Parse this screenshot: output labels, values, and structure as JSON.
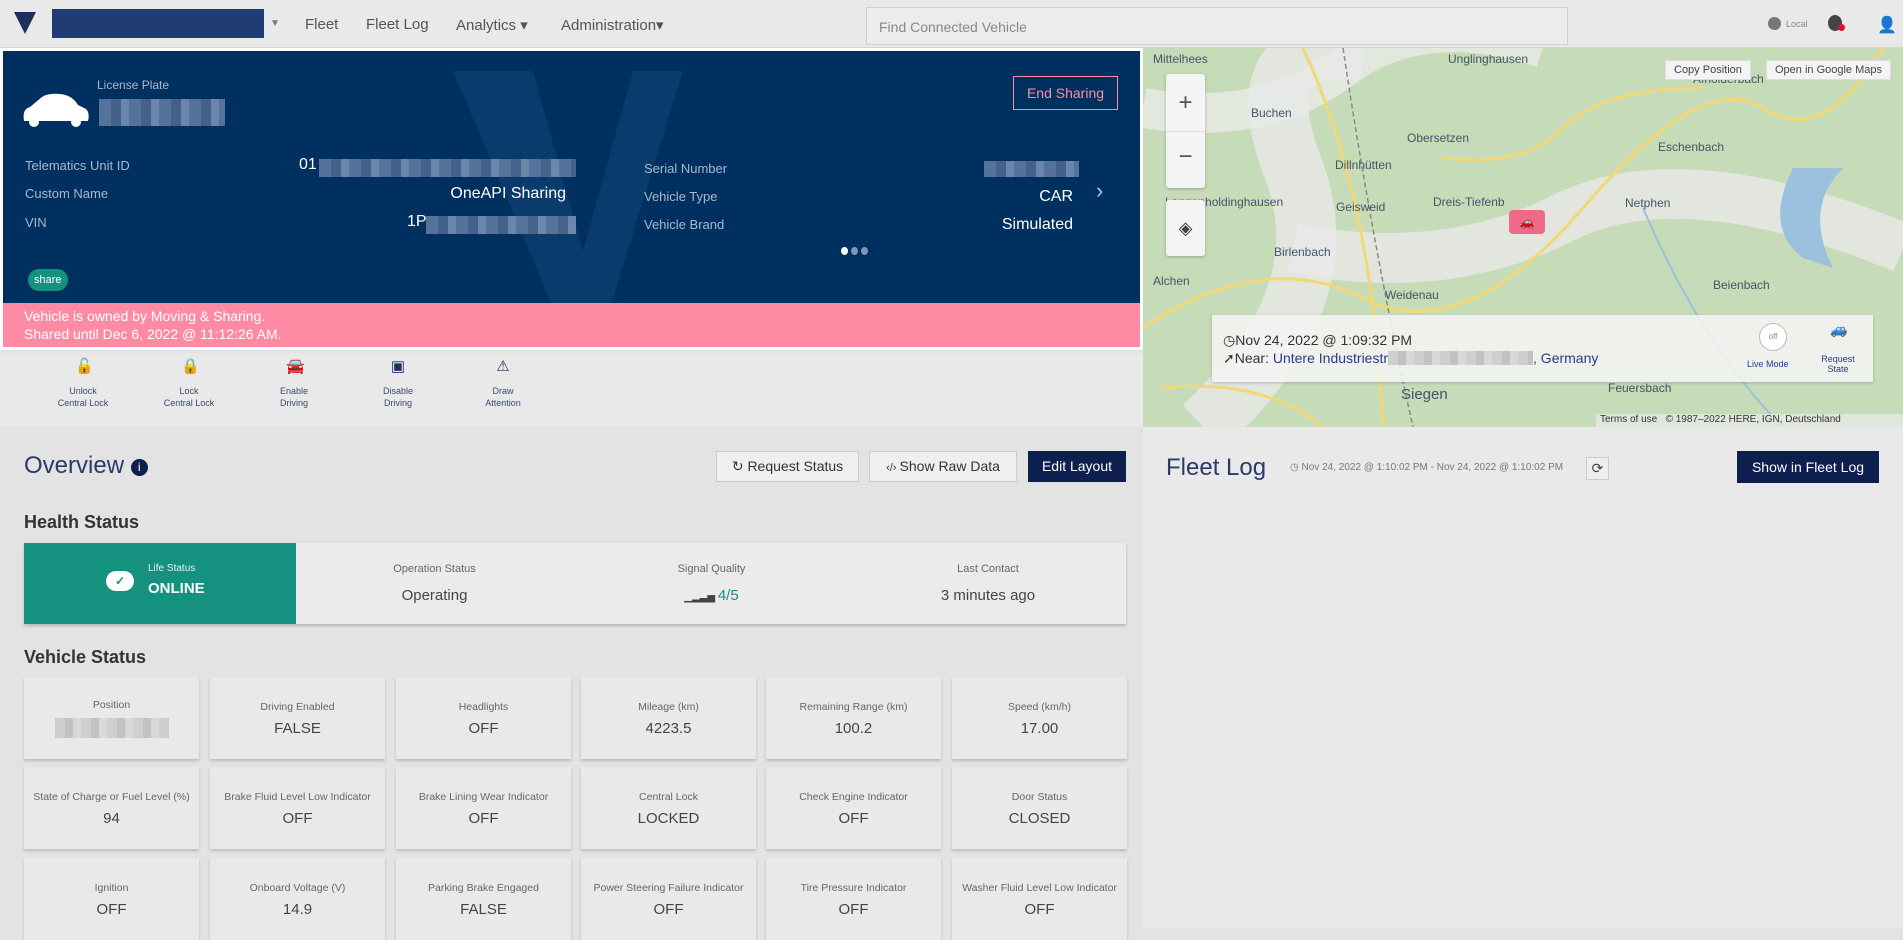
{
  "nav": {
    "menu": [
      "Fleet",
      "Fleet Log",
      "Analytics",
      "Administration"
    ],
    "search_placeholder": "Find Connected Vehicle",
    "locale": "Local"
  },
  "vehicle": {
    "license_plate_label": "License Plate",
    "end_sharing": "End Sharing",
    "fields_left": [
      {
        "label": "Telematics Unit ID",
        "value": "01"
      },
      {
        "label": "Custom Name",
        "value": "OneAPI Sharing"
      },
      {
        "label": "VIN",
        "value": "1P"
      }
    ],
    "fields_right": [
      {
        "label": "Serial Number",
        "value": ""
      },
      {
        "label": "Vehicle Type",
        "value": "CAR"
      },
      {
        "label": "Vehicle Brand",
        "value": "Simulated"
      }
    ],
    "tag": "share",
    "banner_line1": "Vehicle is owned by Moving & Sharing.",
    "banner_line2": "Shared until Dec 6, 2022 @ 11:12:26 AM.",
    "carousel": {
      "pages": 3,
      "active": 1
    }
  },
  "actions": [
    {
      "line1": "Unlock",
      "line2": "Central Lock",
      "icon": "unlock-icon"
    },
    {
      "line1": "Lock",
      "line2": "Central Lock",
      "icon": "lock-icon"
    },
    {
      "line1": "Enable",
      "line2": "Driving",
      "icon": "car-icon"
    },
    {
      "line1": "Disable",
      "line2": "Driving",
      "icon": "disable-icon"
    },
    {
      "line1": "Draw",
      "line2": "Attention",
      "icon": "warning-icon"
    }
  ],
  "overview": {
    "title": "Overview",
    "request_status": "Request Status",
    "show_raw": "Show Raw Data",
    "edit_layout": "Edit Layout",
    "health_title": "Health Status",
    "life_status_label": "Life Status",
    "life_status": "ONLINE",
    "health": [
      {
        "label": "Operation Status",
        "value": "Operating"
      },
      {
        "label": "Signal Quality",
        "value": "4/5"
      },
      {
        "label": "Last Contact",
        "value": "3 minutes ago"
      }
    ],
    "vehicle_status_title": "Vehicle Status",
    "tiles": [
      {
        "label": "Position",
        "value": ""
      },
      {
        "label": "Driving Enabled",
        "value": "FALSE"
      },
      {
        "label": "Headlights",
        "value": "OFF"
      },
      {
        "label": "Mileage (km)",
        "value": "4223.5"
      },
      {
        "label": "Remaining Range (km)",
        "value": "100.2"
      },
      {
        "label": "Speed (km/h)",
        "value": "17.00"
      },
      {
        "label": "State of Charge or Fuel Level (%)",
        "value": "94"
      },
      {
        "label": "Brake Fluid Level Low Indicator",
        "value": "OFF"
      },
      {
        "label": "Brake Lining Wear Indicator",
        "value": "OFF"
      },
      {
        "label": "Central Lock",
        "value": "LOCKED"
      },
      {
        "label": "Check Engine Indicator",
        "value": "OFF"
      },
      {
        "label": "Door Status",
        "value": "CLOSED"
      },
      {
        "label": "Ignition",
        "value": "OFF"
      },
      {
        "label": "Onboard Voltage (V)",
        "value": "14.9"
      },
      {
        "label": "Parking Brake Engaged",
        "value": "FALSE"
      },
      {
        "label": "Power Steering Failure Indicator",
        "value": "OFF"
      },
      {
        "label": "Tire Pressure Indicator",
        "value": "OFF"
      },
      {
        "label": "Washer Fluid Level Low Indicator",
        "value": "OFF"
      }
    ]
  },
  "map": {
    "copy_position": "Copy Position",
    "open_google": "Open in Google Maps",
    "timestamp": "Nov 24, 2022 @ 1:09:32 PM",
    "near_label": "Near:",
    "near_value": "Untere Industriestr",
    "near_country": ", Germany",
    "live_mode": "Live Mode",
    "live_toggle": "off",
    "request_state": "Request State",
    "terms": "Terms of use",
    "copyright": "© 1987–2022 HERE, IGN, Deutschland",
    "places": [
      "Mittelhees",
      "Unglinghausen",
      "Afholderbach",
      "Buchen",
      "Obersetzen",
      "Eschenbach",
      "Dillnhütten",
      "Langenholdinghausen",
      "Geisweid",
      "Dreis-Tiefenb",
      "Netphen",
      "Birlenbach",
      "Alchen",
      "Weidenau",
      "Beienbach",
      "Siegen",
      "Feuersbach"
    ]
  },
  "fleet_log": {
    "title": "Fleet Log",
    "range": "Nov 24, 2022 @ 1:10:02 PM - Nov 24, 2022 @ 1:10:02 PM",
    "show": "Show in Fleet Log"
  },
  "colors": {
    "navy": "#003060",
    "pink": "#ff8aa3",
    "teal": "#14927f",
    "button_dark": "#0d1f4f"
  }
}
